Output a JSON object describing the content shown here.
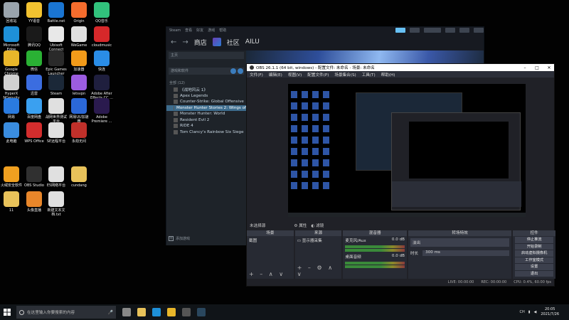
{
  "desktop": {
    "icons": [
      {
        "label": "回收站",
        "icon": "recycle-bin-icon",
        "color": "#9aa4ad"
      },
      {
        "label": "YY语音",
        "icon": "yy-icon",
        "color": "#f2c230"
      },
      {
        "label": "Battle.net",
        "icon": "battlenet-icon",
        "color": "#1a75d2"
      },
      {
        "label": "Origin",
        "icon": "origin-icon",
        "color": "#f56c2d"
      },
      {
        "label": "QQ音乐",
        "icon": "qqmusic-icon",
        "color": "#31c27c"
      },
      {
        "label": "Microsoft Edge",
        "icon": "edge-icon",
        "color": "#1e90d8"
      },
      {
        "label": "腾讯QQ",
        "icon": "qq-icon",
        "color": "#1a1a1a"
      },
      {
        "label": "Ubisoft Connect",
        "icon": "ubisoft-icon",
        "color": "#e8e8e8"
      },
      {
        "label": "WeGame",
        "icon": "file-icon",
        "color": "#e0e0e0"
      },
      {
        "label": "cloudmusic",
        "icon": "netease-music-icon",
        "color": "#d6282a"
      },
      {
        "label": "Google Chrome",
        "icon": "chrome-icon",
        "color": "#e8b62a"
      },
      {
        "label": "微信",
        "icon": "wechat-icon",
        "color": "#2ab134"
      },
      {
        "label": "Epic Games Launcher",
        "icon": "epic-icon",
        "color": "#2a2a2a"
      },
      {
        "label": "加速器",
        "icon": "accelerator-icon",
        "color": "#f29b1a"
      },
      {
        "label": "快连",
        "icon": "vpn-icon",
        "color": "#2a8de6"
      },
      {
        "label": "HyperX NGenuity",
        "icon": "hyperx-icon",
        "color": "#d0d0d0"
      },
      {
        "label": "迅雷",
        "icon": "xunlei-icon",
        "color": "#3b6de0"
      },
      {
        "label": "Steam",
        "icon": "steam-icon",
        "color": "#1b2838"
      },
      {
        "label": "letsvpn",
        "icon": "letsvpn-icon",
        "color": "#9c5ce0"
      },
      {
        "label": "Adobe After Effects CC ...",
        "icon": "after-effects-icon",
        "color": "#1f1f3e"
      },
      {
        "label": "网易",
        "icon": "netease-icon",
        "color": "#2a7be0"
      },
      {
        "label": "百度网盘",
        "icon": "baidu-netdisk-icon",
        "color": "#3aa0f0"
      },
      {
        "label": "战网世界测试平台",
        "icon": "file-icon",
        "color": "#e0e0e0"
      },
      {
        "label": "网易UU加速器",
        "icon": "uu-icon",
        "color": "#2b68d8"
      },
      {
        "label": "Adobe Premiere ...",
        "icon": "premiere-icon",
        "color": "#2a1a4e"
      },
      {
        "label": "此电脑",
        "icon": "this-pc-icon",
        "color": "#3a8de0"
      },
      {
        "label": "WPS Office",
        "icon": "wps-icon",
        "color": "#d32d2d"
      },
      {
        "label": "SE远程平台",
        "icon": "file-icon",
        "color": "#e0e0e0"
      },
      {
        "label": "永劫无间",
        "icon": "naraka-icon",
        "color": "#c0302a"
      },
      {
        "label": "火绒安全软件",
        "icon": "huorong-icon",
        "color": "#f0a020"
      },
      {
        "label": "OBS Studio",
        "icon": "obs-icon",
        "color": "#303030"
      },
      {
        "label": "E5网络平台",
        "icon": "file-icon",
        "color": "#e0e0e0"
      },
      {
        "label": "cundang",
        "icon": "folder-icon",
        "color": "#e8c25a"
      },
      {
        "label": "11",
        "icon": "folder-icon",
        "color": "#e8c25a"
      },
      {
        "label": "头像直播",
        "icon": "stream-icon",
        "color": "#e8862a"
      },
      {
        "label": "新建文本文档.txt",
        "icon": "text-file-icon",
        "color": "#e0e0e0"
      }
    ]
  },
  "steam": {
    "menu": [
      "Steam",
      "查看",
      "好友",
      "游戏",
      "帮助"
    ],
    "nav": {
      "store": "商店",
      "community": "社区",
      "user": "AILU"
    },
    "home_label": "主页",
    "filter_label": "游戏和软件",
    "category": "全部 (12)",
    "games": [
      "《战地风云 1》",
      "Apex Legends",
      "Counter-Strike: Global Offensive",
      "Monster Hunter Stories 2: Wings of",
      "Monster Hunter: World",
      "Resident Evil 2",
      "RIDE 4",
      "Tom Clancy's Rainbow Six Siege"
    ],
    "selected_game_index": 3,
    "add_game": "添加游戏",
    "accent_color": "#67c1f5"
  },
  "obs": {
    "title": "OBS 26.1.1 (64 bit, windows) - 配置文件: 未命名 - 场景: 未命名",
    "menu": [
      "文件(F)",
      "编辑(E)",
      "视图(V)",
      "配置文件(P)",
      "场景集合(S)",
      "工具(T)",
      "帮助(H)"
    ],
    "source_selected": "未选择源",
    "props_btn": "属性",
    "filters_btn": "滤镜",
    "docks": {
      "scenes": {
        "title": "场景",
        "item": "截图"
      },
      "sources": {
        "title": "来源",
        "item": "显示器采集"
      },
      "mixer": {
        "title": "混音器",
        "ch1": {
          "name": "麦克风/Aux",
          "db": "0.0 dB"
        },
        "ch2": {
          "name": "桌面音频",
          "db": "0.0 dB"
        }
      },
      "transitions": {
        "title": "转场特效",
        "type": "淡出",
        "duration_label": "时长",
        "duration": "300 ms"
      },
      "controls": {
        "title": "控件",
        "buttons": [
          "停止推流",
          "开始录制",
          "启动虚拟摄像机",
          "工作室模式",
          "设置",
          "退出"
        ]
      }
    },
    "status": {
      "live": "LIVE: 00:00:00",
      "rec": "REC: 00:00:00",
      "cpu": "CPU: 0.4%, 60.00 fps"
    }
  },
  "taskbar": {
    "search_placeholder": "在这里输入你要搜索的内容",
    "apps": [
      {
        "icon": "task-view-icon",
        "color": "#888888"
      },
      {
        "icon": "file-explorer-icon",
        "color": "#e8c25a"
      },
      {
        "icon": "edge-icon",
        "color": "#1e90d8"
      },
      {
        "icon": "chrome-icon",
        "color": "#e8b62a"
      },
      {
        "icon": "obs-icon",
        "color": "#555555"
      },
      {
        "icon": "steam-icon",
        "color": "#2a475e"
      }
    ],
    "tray_temp": "CH",
    "time": "20:05",
    "date": "2021/7/26"
  }
}
